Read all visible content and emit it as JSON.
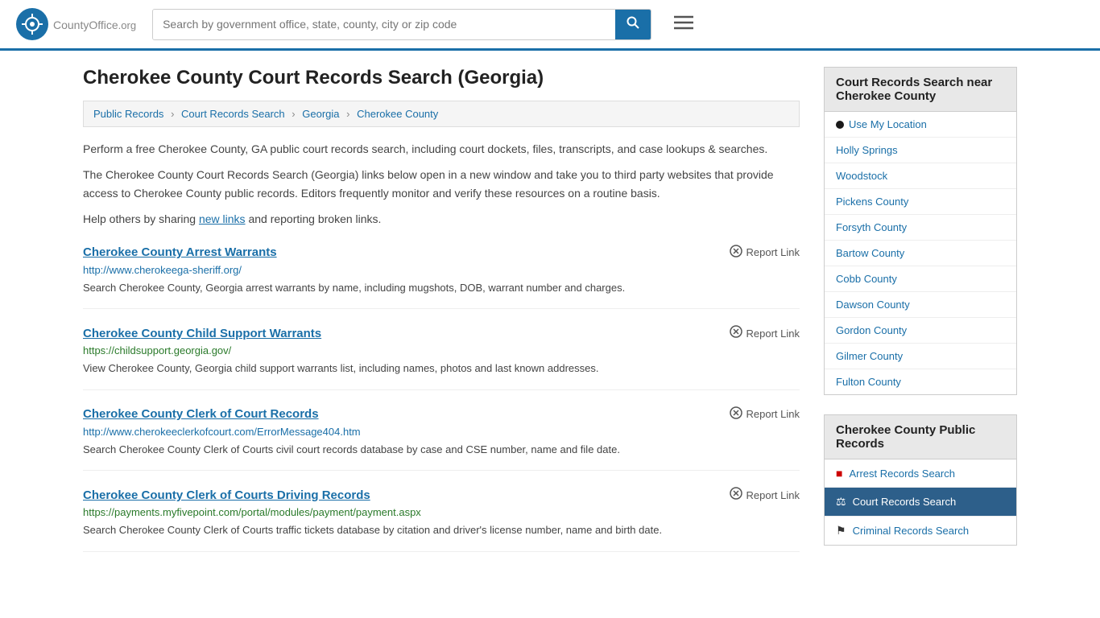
{
  "header": {
    "logo_text": "CountyOffice",
    "logo_suffix": ".org",
    "search_placeholder": "Search by government office, state, county, city or zip code"
  },
  "page": {
    "title": "Cherokee County Court Records Search (Georgia)",
    "breadcrumb": [
      {
        "label": "Public Records",
        "href": "#"
      },
      {
        "label": "Court Records Search",
        "href": "#"
      },
      {
        "label": "Georgia",
        "href": "#"
      },
      {
        "label": "Cherokee County",
        "href": "#"
      }
    ],
    "description1": "Perform a free Cherokee County, GA public court records search, including court dockets, files, transcripts, and case lookups & searches.",
    "description2": "The Cherokee County Court Records Search (Georgia) links below open in a new window and take you to third party websites that provide access to Cherokee County public records. Editors frequently monitor and verify these resources on a routine basis.",
    "description3_prefix": "Help others by sharing ",
    "description3_link": "new links",
    "description3_suffix": " and reporting broken links."
  },
  "records": [
    {
      "title": "Cherokee County Arrest Warrants",
      "url": "http://www.cherokeega-sheriff.org/",
      "url_color": "blue-link",
      "description": "Search Cherokee County, Georgia arrest warrants by name, including mugshots, DOB, warrant number and charges."
    },
    {
      "title": "Cherokee County Child Support Warrants",
      "url": "https://childsupport.georgia.gov/",
      "url_color": "green",
      "description": "View Cherokee County, Georgia child support warrants list, including names, photos and last known addresses."
    },
    {
      "title": "Cherokee County Clerk of Court Records",
      "url": "http://www.cherokeeclerkofcourt.com/ErrorMessage404.htm",
      "url_color": "blue-link",
      "description": "Search Cherokee County Clerk of Courts civil court records database by case and CSE number, name and file date."
    },
    {
      "title": "Cherokee County Clerk of Courts Driving Records",
      "url": "https://payments.myfivepoint.com/portal/modules/payment/payment.aspx",
      "url_color": "green",
      "description": "Search Cherokee County Clerk of Courts traffic tickets database by citation and driver's license number, name and birth date."
    }
  ],
  "report_link_label": "Report Link",
  "sidebar": {
    "nearby_header": "Court Records Search near Cherokee County",
    "nearby_items": [
      {
        "label": "Use My Location",
        "href": "#",
        "special": "location"
      },
      {
        "label": "Holly Springs",
        "href": "#"
      },
      {
        "label": "Woodstock",
        "href": "#"
      },
      {
        "label": "Pickens County",
        "href": "#"
      },
      {
        "label": "Forsyth County",
        "href": "#"
      },
      {
        "label": "Bartow County",
        "href": "#"
      },
      {
        "label": "Cobb County",
        "href": "#"
      },
      {
        "label": "Dawson County",
        "href": "#"
      },
      {
        "label": "Gordon County",
        "href": "#"
      },
      {
        "label": "Gilmer County",
        "href": "#"
      },
      {
        "label": "Fulton County",
        "href": "#"
      }
    ],
    "public_header": "Cherokee County Public Records",
    "public_items": [
      {
        "label": "Arrest Records Search",
        "href": "#",
        "icon": "■",
        "icon_class": "red",
        "active": false
      },
      {
        "label": "Court Records Search",
        "href": "#",
        "icon": "⚖",
        "icon_class": "white",
        "active": true
      },
      {
        "label": "Criminal Records Search",
        "href": "#",
        "icon": "⚑",
        "icon_class": "dark",
        "active": false
      }
    ]
  }
}
